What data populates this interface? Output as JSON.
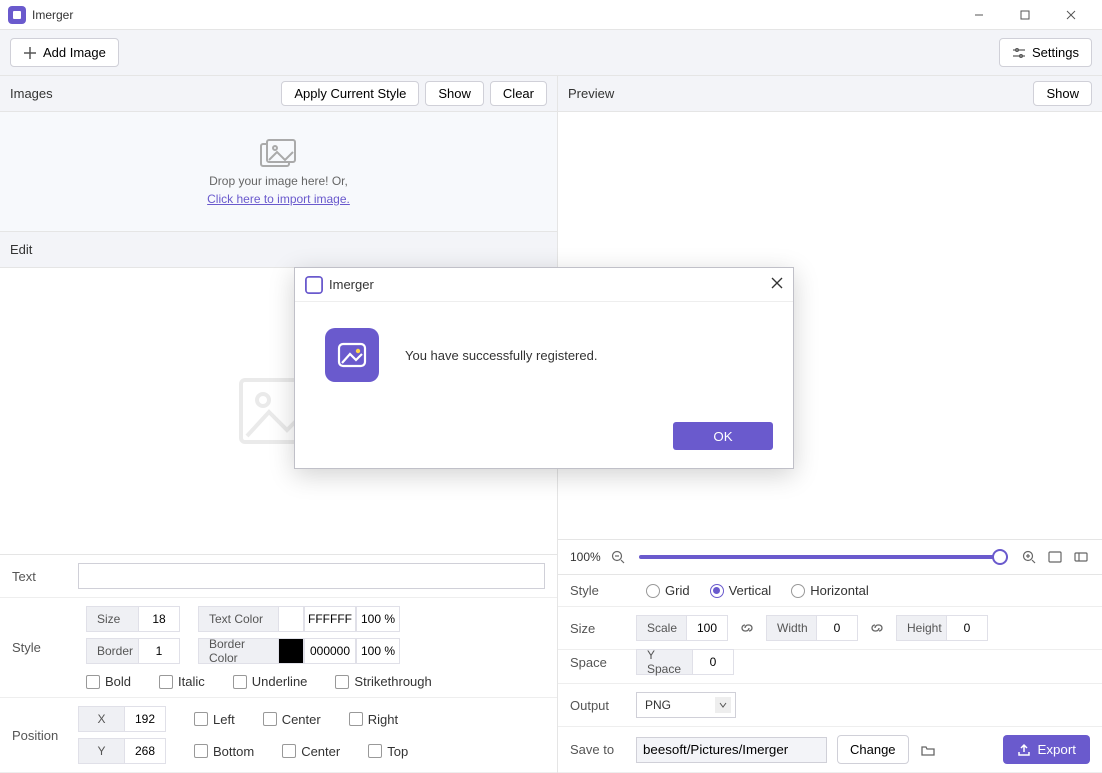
{
  "app_title": "Imerger",
  "toolbar": {
    "add_image": "Add Image",
    "settings": "Settings"
  },
  "images": {
    "header": "Images",
    "apply_style": "Apply Current Style",
    "show": "Show",
    "clear": "Clear",
    "drop_text": "Drop your image here! Or,",
    "import_link": "Click here to import image."
  },
  "edit": {
    "header": "Edit",
    "text_label": "Text",
    "text_value": "",
    "style_label": "Style",
    "size_label": "Size",
    "size_value": "18",
    "text_color_label": "Text Color",
    "text_color_value": "FFFFFF",
    "text_color_pct": "100 %",
    "border_label": "Border",
    "border_value": "1",
    "border_color_label": "Border Color",
    "border_color_value": "000000",
    "border_color_pct": "100 %",
    "bold": "Bold",
    "italic": "Italic",
    "underline": "Underline",
    "strike": "Strikethrough",
    "position_label": "Position",
    "x_label": "X",
    "x_value": "192",
    "y_label": "Y",
    "y_value": "268",
    "left": "Left",
    "center": "Center",
    "right": "Right",
    "bottom": "Bottom",
    "top": "Top"
  },
  "preview": {
    "header": "Preview",
    "show": "Show",
    "zoom_pct": "100%",
    "style_label": "Style",
    "grid": "Grid",
    "vertical": "Vertical",
    "horizontal": "Horizontal",
    "size_label": "Size",
    "scale_label": "Scale",
    "scale_value": "100",
    "width_label": "Width",
    "width_value": "0",
    "height_label": "Height",
    "height_value": "0",
    "space_label": "Space",
    "yspace_label": "Y Space",
    "yspace_value": "0",
    "output_label": "Output",
    "output_value": "PNG",
    "saveto_label": "Save to",
    "saveto_value": "beesoft/Pictures/Imerger",
    "change": "Change",
    "export": "Export"
  },
  "dialog": {
    "title": "Imerger",
    "message": "You have successfully registered.",
    "ok": "OK"
  },
  "colors": {
    "accent": "#6a5acd"
  }
}
